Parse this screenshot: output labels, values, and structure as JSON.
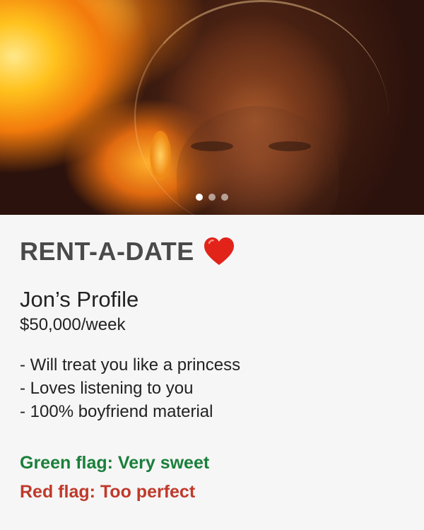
{
  "profile_photo": {
    "carousel": {
      "count": 3,
      "active_index": 0
    }
  },
  "app": {
    "title": "RENT-A-DATE",
    "title_icon": "heart-icon",
    "heart_color": "#e2231a"
  },
  "profile": {
    "name_heading": "Jon’s Profile",
    "price": "$50,000/week",
    "bullets": [
      "- Will treat you like a princess",
      "- Loves listening to you",
      "- 100% boyfriend material"
    ],
    "green_flag": "Green flag: Very sweet",
    "red_flag": "Red flag: Too perfect",
    "green_color": "#1a7f3a",
    "red_color": "#c0392b"
  }
}
